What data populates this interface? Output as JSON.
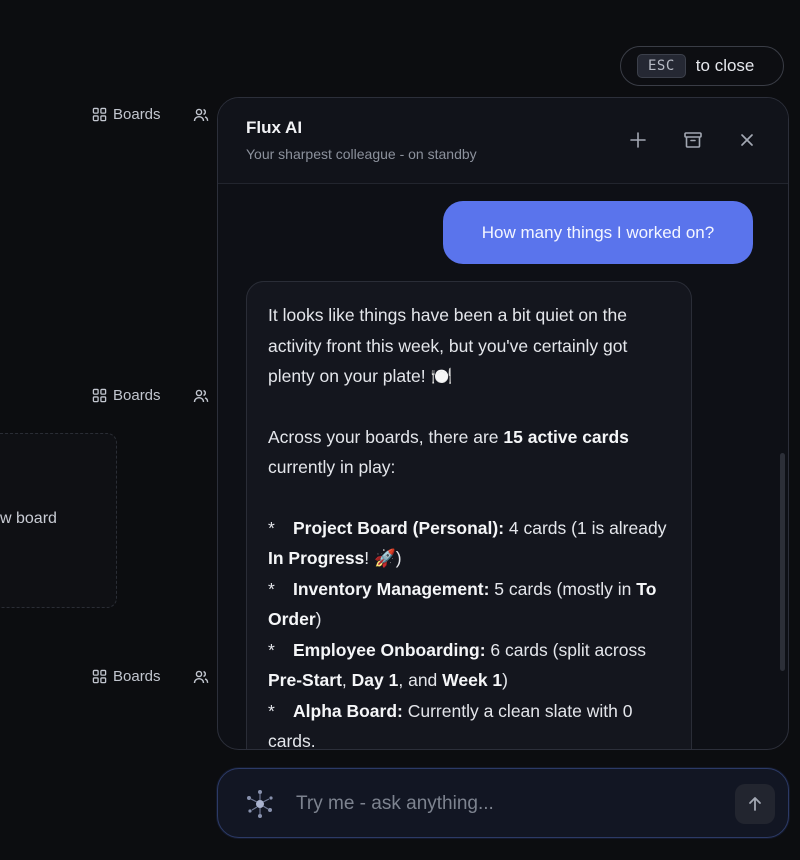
{
  "background": {
    "rows": [
      {
        "boards_label": "Boards"
      },
      {
        "boards_label": "Boards"
      },
      {
        "boards_label": "Boards"
      }
    ],
    "new_board_label": "w board"
  },
  "esc": {
    "key": "ESC",
    "text": "to close"
  },
  "chat": {
    "title": "Flux AI",
    "subtitle": "Your sharpest colleague - on standby",
    "header_icons": [
      "plus-icon",
      "archive-icon",
      "close-icon"
    ],
    "user_message": "How many things I worked on?",
    "ai_reply": {
      "intro": "It looks like things have been a bit quiet on the activity front this week, but you've certainly got plenty on your plate! 🍽️",
      "summary_pre": "Across your boards, there are ",
      "summary_bold": "15 active cards",
      "summary_post": " currently in play:",
      "bullets": [
        {
          "marker": "*",
          "name": "Project Board (Personal):",
          "text_a": " 4 cards (1 is already ",
          "bold_a": "In Progress",
          "text_b": "! 🚀)"
        },
        {
          "marker": "*",
          "name": "Inventory Management:",
          "text_a": " 5 cards (mostly in ",
          "bold_a": "To Order",
          "text_b": ")"
        },
        {
          "marker": "*",
          "name": "Employee Onboarding:",
          "text_a": " 6 cards (split across ",
          "bold_a": "Pre-Start",
          "text_b": ", ",
          "bold_b": "Day 1",
          "text_c": ", and ",
          "bold_c": "Week 1",
          "text_d": ")"
        },
        {
          "marker": "*",
          "name": "Alpha Board:",
          "text_a": " Currently a clean slate with 0 cards."
        }
      ]
    }
  },
  "input": {
    "placeholder": "Try me - ask anything...",
    "value": ""
  },
  "colors": {
    "accent": "#5a74ec",
    "panel_bg": "#0e1016",
    "page_bg": "#0c0d10",
    "input_border": "#2c3a66"
  }
}
